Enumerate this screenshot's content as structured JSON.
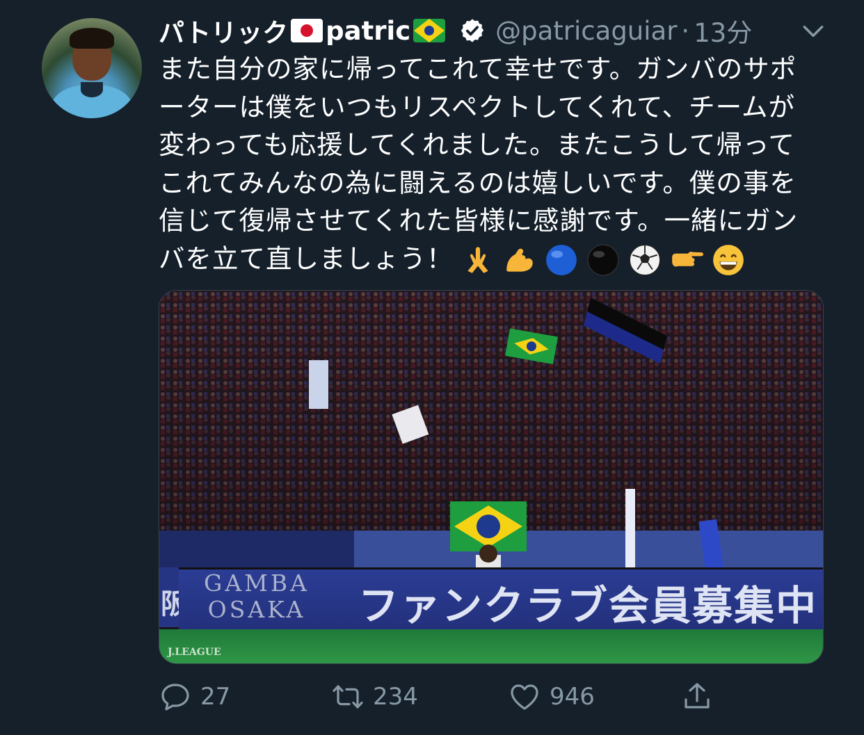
{
  "tweet": {
    "display_name": "パトリック",
    "display_name_suffix": "patric",
    "handle": "@patricaguiar",
    "separator": "·",
    "time": "13分",
    "lines": [
      "また自分の家に帰ってこれて幸せです。ガンバのサポ",
      "ーターは僕をいつもリスペクトしてくれて、チームが",
      "変わっても応援してくれました。またこうして帰って",
      "これてみんなの為に闘えるのは嬉しいです。僕の事を",
      "信じて復帰させてくれた皆様に感謝です。一緒にガン",
      "バを立て直しましょう！"
    ],
    "emojis": [
      "folded-hands",
      "flexed-biceps",
      "blue-circle",
      "black-circle",
      "soccer-ball",
      "backhand-index-pointing-right",
      "beaming-face"
    ]
  },
  "media": {
    "banner_side": "阪",
    "banner_club": [
      "GAMBA",
      "OSAKA"
    ],
    "banner_message": "ファンクラブ会員募集中！",
    "league_mark": "J.LEAGUE"
  },
  "actions": {
    "reply_count": "27",
    "retweet_count": "234",
    "like_count": "946"
  },
  "colors": {
    "background": "#15202b",
    "text": "#ffffff",
    "muted": "#8899a6",
    "verified": "#ffffff"
  }
}
